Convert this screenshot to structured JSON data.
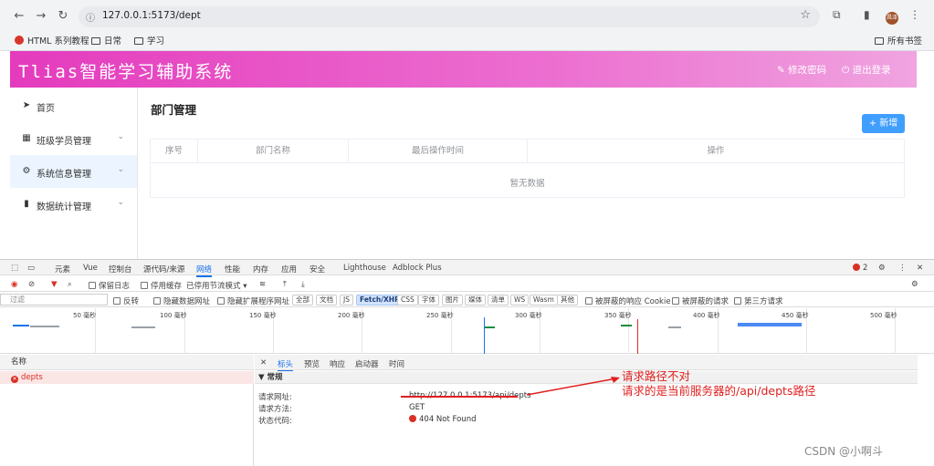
{
  "browser": {
    "url": "127.0.0.1:5173/dept",
    "avatar_text": "昌泽",
    "bookmarks": [
      "HTML 系列教程",
      "日常",
      "学习"
    ],
    "all_bookmarks": "所有书签"
  },
  "app": {
    "title": "Tlias智能学习辅助系统",
    "header_links": [
      "修改密码",
      "退出登录"
    ],
    "sidebar": [
      {
        "label": "首页",
        "icon": "send-icon"
      },
      {
        "label": "班级学员管理",
        "icon": "grid-icon"
      },
      {
        "label": "系统信息管理",
        "icon": "gear-icon"
      },
      {
        "label": "数据统计管理",
        "icon": "bar-chart-icon"
      }
    ],
    "page_title": "部门管理",
    "add_button": "+ 新增",
    "columns": [
      "序号",
      "部门名称",
      "最后操作时间",
      "操作"
    ],
    "empty_text": "暂无数据"
  },
  "devtools": {
    "tabs": [
      "元素",
      "Vue",
      "控制台",
      "源代码/来源",
      "网络",
      "性能",
      "内存",
      "应用",
      "安全",
      "Lighthouse",
      "Adblock Plus"
    ],
    "active_tab": "网络",
    "error_count": "2",
    "toolbar": [
      "保留日志",
      "停用缓存",
      "已停用节流模式"
    ],
    "filter_placeholder": "过滤",
    "filter_options": [
      "反转",
      "隐藏数据网址",
      "隐藏扩展程序网址"
    ],
    "chips": [
      "全部",
      "文档",
      "JS",
      "Fetch/XHR",
      "CSS",
      "字体",
      "图片",
      "媒体",
      "清单",
      "WS",
      "Wasm",
      "其他"
    ],
    "extra_filters": [
      "被屏蔽的响应 Cookie",
      "被屏蔽的请求",
      "第三方请求"
    ],
    "timeline_ticks": [
      "50 毫秒",
      "100 毫秒",
      "150 毫秒",
      "200 毫秒",
      "250 毫秒",
      "300 毫秒",
      "350 毫秒",
      "400 毫秒",
      "450 毫秒",
      "500 毫秒"
    ],
    "name_header": "名称",
    "request_name": "depts",
    "detail_tabs": [
      "标头",
      "预览",
      "响应",
      "启动器",
      "时间"
    ],
    "section": "▼ 常规",
    "general": [
      {
        "key": "请求网址:",
        "value": "http://127.0.0.1:5173/api/depts"
      },
      {
        "key": "请求方法:",
        "value": "GET"
      },
      {
        "key": "状态代码:",
        "value": "404 Not Found"
      }
    ]
  },
  "annotation": {
    "line1": "请求路径不对",
    "line2": "请求的是当前服务器的/api/depts路径",
    "color": "#e02020"
  },
  "watermark": "CSDN @小啊斗"
}
